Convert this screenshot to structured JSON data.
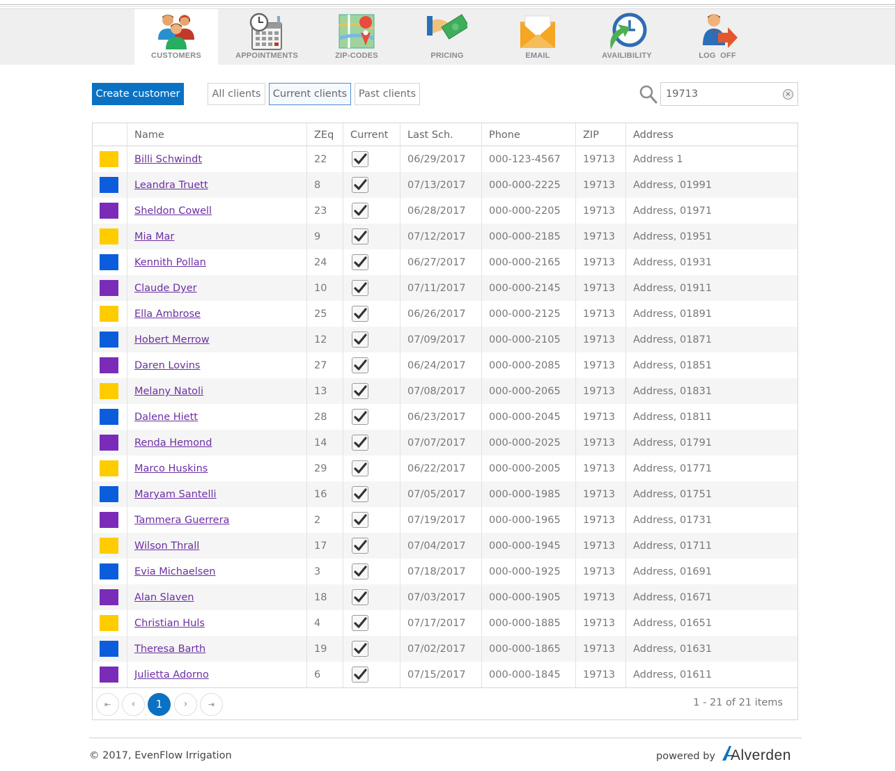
{
  "nav": {
    "items": [
      {
        "label": "CUSTOMERS",
        "icon": "customers-icon",
        "active": true
      },
      {
        "label": "APPOINTMENTS",
        "icon": "calendar-icon",
        "active": false
      },
      {
        "label": "ZIP-CODES",
        "icon": "map-icon",
        "active": false
      },
      {
        "label": "PRICING",
        "icon": "money-icon",
        "active": false
      },
      {
        "label": "EMAIL",
        "icon": "envelope-icon",
        "active": false
      },
      {
        "label": "AVAILIBILITY",
        "icon": "clock-icon",
        "active": false
      },
      {
        "label": "LOG  OFF",
        "icon": "logoff-icon",
        "active": false
      }
    ]
  },
  "toolbar": {
    "create_label": "Create customer",
    "filters": [
      {
        "label": "All clients",
        "selected": false
      },
      {
        "label": "Current clients",
        "selected": true
      },
      {
        "label": "Past clients",
        "selected": false
      }
    ],
    "search_value": "19713",
    "clear_symbol": "×"
  },
  "grid": {
    "columns": [
      "",
      "Name",
      "ZEq",
      "Current",
      "Last Sch.",
      "Phone",
      "ZIP",
      "Address"
    ],
    "colors": {
      "yellow": "#ffcc00",
      "blue": "#0b5ddb",
      "purple": "#7a2cb8"
    },
    "rows": [
      {
        "color": "yellow",
        "name": "Billi Schwindt",
        "zeq": "22",
        "current": true,
        "last": "06/29/2017",
        "phone": "000-123-4567",
        "zip": "19713",
        "address": "Address 1"
      },
      {
        "color": "blue",
        "name": "Leandra Truett",
        "zeq": "8",
        "current": true,
        "last": "07/13/2017",
        "phone": "000-000-2225",
        "zip": "19713",
        "address": "Address, 01991"
      },
      {
        "color": "purple",
        "name": "Sheldon Cowell",
        "zeq": "23",
        "current": true,
        "last": "06/28/2017",
        "phone": "000-000-2205",
        "zip": "19713",
        "address": "Address, 01971"
      },
      {
        "color": "yellow",
        "name": "Mia Mar",
        "zeq": "9",
        "current": true,
        "last": "07/12/2017",
        "phone": "000-000-2185",
        "zip": "19713",
        "address": "Address, 01951"
      },
      {
        "color": "blue",
        "name": "Kennith Pollan",
        "zeq": "24",
        "current": true,
        "last": "06/27/2017",
        "phone": "000-000-2165",
        "zip": "19713",
        "address": "Address, 01931"
      },
      {
        "color": "purple",
        "name": "Claude Dyer",
        "zeq": "10",
        "current": true,
        "last": "07/11/2017",
        "phone": "000-000-2145",
        "zip": "19713",
        "address": "Address, 01911"
      },
      {
        "color": "yellow",
        "name": "Ella Ambrose",
        "zeq": "25",
        "current": true,
        "last": "06/26/2017",
        "phone": "000-000-2125",
        "zip": "19713",
        "address": "Address, 01891"
      },
      {
        "color": "blue",
        "name": "Hobert Merrow",
        "zeq": "12",
        "current": true,
        "last": "07/09/2017",
        "phone": "000-000-2105",
        "zip": "19713",
        "address": "Address, 01871"
      },
      {
        "color": "purple",
        "name": "Daren Lovins",
        "zeq": "27",
        "current": true,
        "last": "06/24/2017",
        "phone": "000-000-2085",
        "zip": "19713",
        "address": "Address, 01851"
      },
      {
        "color": "yellow",
        "name": "Melany Natoli",
        "zeq": "13",
        "current": true,
        "last": "07/08/2017",
        "phone": "000-000-2065",
        "zip": "19713",
        "address": "Address, 01831"
      },
      {
        "color": "blue",
        "name": "Dalene Hiett",
        "zeq": "28",
        "current": true,
        "last": "06/23/2017",
        "phone": "000-000-2045",
        "zip": "19713",
        "address": "Address, 01811"
      },
      {
        "color": "purple",
        "name": "Renda Hemond",
        "zeq": "14",
        "current": true,
        "last": "07/07/2017",
        "phone": "000-000-2025",
        "zip": "19713",
        "address": "Address, 01791"
      },
      {
        "color": "yellow",
        "name": "Marco Huskins",
        "zeq": "29",
        "current": true,
        "last": "06/22/2017",
        "phone": "000-000-2005",
        "zip": "19713",
        "address": "Address, 01771"
      },
      {
        "color": "blue",
        "name": "Maryam Santelli",
        "zeq": "16",
        "current": true,
        "last": "07/05/2017",
        "phone": "000-000-1985",
        "zip": "19713",
        "address": "Address, 01751"
      },
      {
        "color": "purple",
        "name": "Tammera Guerrera",
        "zeq": "2",
        "current": true,
        "last": "07/19/2017",
        "phone": "000-000-1965",
        "zip": "19713",
        "address": "Address, 01731"
      },
      {
        "color": "yellow",
        "name": "Wilson Thrall",
        "zeq": "17",
        "current": true,
        "last": "07/04/2017",
        "phone": "000-000-1945",
        "zip": "19713",
        "address": "Address, 01711"
      },
      {
        "color": "blue",
        "name": "Evia Michaelsen",
        "zeq": "3",
        "current": true,
        "last": "07/18/2017",
        "phone": "000-000-1925",
        "zip": "19713",
        "address": "Address, 01691"
      },
      {
        "color": "purple",
        "name": "Alan Slaven",
        "zeq": "18",
        "current": true,
        "last": "07/03/2017",
        "phone": "000-000-1905",
        "zip": "19713",
        "address": "Address, 01671"
      },
      {
        "color": "yellow",
        "name": "Christian Huls",
        "zeq": "4",
        "current": true,
        "last": "07/17/2017",
        "phone": "000-000-1885",
        "zip": "19713",
        "address": "Address, 01651"
      },
      {
        "color": "blue",
        "name": "Theresa Barth",
        "zeq": "19",
        "current": true,
        "last": "07/02/2017",
        "phone": "000-000-1865",
        "zip": "19713",
        "address": "Address, 01631"
      },
      {
        "color": "purple",
        "name": "Julietta Adorno",
        "zeq": "6",
        "current": true,
        "last": "07/15/2017",
        "phone": "000-000-1845",
        "zip": "19713",
        "address": "Address, 01611"
      }
    ]
  },
  "pager": {
    "first_symbol": "⇤",
    "prev_symbol": "‹",
    "current_page": "1",
    "next_symbol": "›",
    "last_symbol": "⇥",
    "info": "1 - 21 of 21 items"
  },
  "footer": {
    "copyright": "© 2017, EvenFlow Irrigation",
    "powered_by": "powered by",
    "brand": "Alverden",
    "accent": "#0b72c3"
  }
}
